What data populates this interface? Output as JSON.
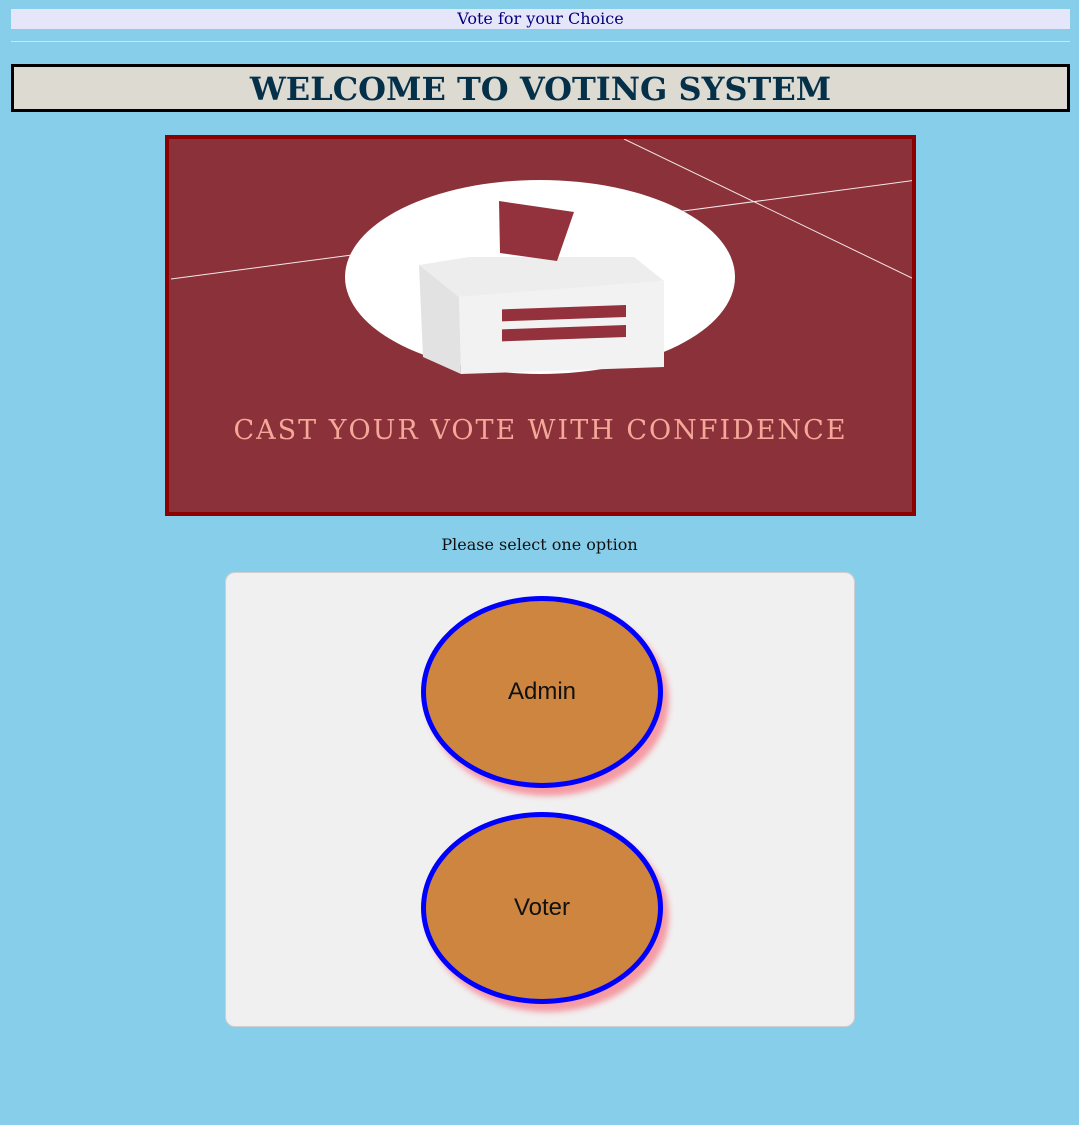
{
  "header": {
    "tagline": "Vote for your Choice",
    "title": "WELCOME TO VOTING SYSTEM"
  },
  "banner": {
    "caption": "CAST YOUR VOTE WITH CONFIDENCE",
    "image": "ballot-box-illustration",
    "colors": {
      "background": "#8a313a",
      "border": "#8b0000",
      "caption": "#f5a899"
    }
  },
  "prompt": "Please select one option",
  "options": {
    "admin_label": "Admin",
    "voter_label": "Voter"
  },
  "colors": {
    "page_background": "#87ceeb",
    "button_fill": "#cd853f",
    "button_border": "#0000ff"
  }
}
